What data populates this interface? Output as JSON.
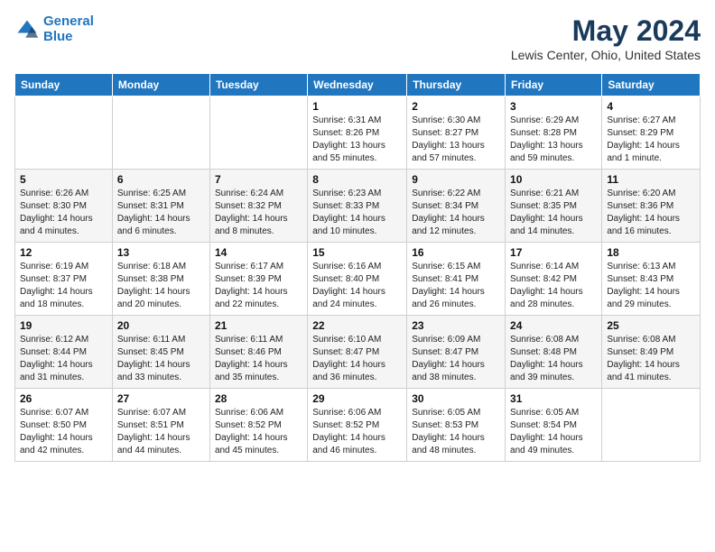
{
  "header": {
    "logo_line1": "General",
    "logo_line2": "Blue",
    "month_title": "May 2024",
    "location": "Lewis Center, Ohio, United States"
  },
  "days_of_week": [
    "Sunday",
    "Monday",
    "Tuesday",
    "Wednesday",
    "Thursday",
    "Friday",
    "Saturday"
  ],
  "weeks": [
    [
      {
        "day": "",
        "info": ""
      },
      {
        "day": "",
        "info": ""
      },
      {
        "day": "",
        "info": ""
      },
      {
        "day": "1",
        "info": "Sunrise: 6:31 AM\nSunset: 8:26 PM\nDaylight: 13 hours\nand 55 minutes."
      },
      {
        "day": "2",
        "info": "Sunrise: 6:30 AM\nSunset: 8:27 PM\nDaylight: 13 hours\nand 57 minutes."
      },
      {
        "day": "3",
        "info": "Sunrise: 6:29 AM\nSunset: 8:28 PM\nDaylight: 13 hours\nand 59 minutes."
      },
      {
        "day": "4",
        "info": "Sunrise: 6:27 AM\nSunset: 8:29 PM\nDaylight: 14 hours\nand 1 minute."
      }
    ],
    [
      {
        "day": "5",
        "info": "Sunrise: 6:26 AM\nSunset: 8:30 PM\nDaylight: 14 hours\nand 4 minutes."
      },
      {
        "day": "6",
        "info": "Sunrise: 6:25 AM\nSunset: 8:31 PM\nDaylight: 14 hours\nand 6 minutes."
      },
      {
        "day": "7",
        "info": "Sunrise: 6:24 AM\nSunset: 8:32 PM\nDaylight: 14 hours\nand 8 minutes."
      },
      {
        "day": "8",
        "info": "Sunrise: 6:23 AM\nSunset: 8:33 PM\nDaylight: 14 hours\nand 10 minutes."
      },
      {
        "day": "9",
        "info": "Sunrise: 6:22 AM\nSunset: 8:34 PM\nDaylight: 14 hours\nand 12 minutes."
      },
      {
        "day": "10",
        "info": "Sunrise: 6:21 AM\nSunset: 8:35 PM\nDaylight: 14 hours\nand 14 minutes."
      },
      {
        "day": "11",
        "info": "Sunrise: 6:20 AM\nSunset: 8:36 PM\nDaylight: 14 hours\nand 16 minutes."
      }
    ],
    [
      {
        "day": "12",
        "info": "Sunrise: 6:19 AM\nSunset: 8:37 PM\nDaylight: 14 hours\nand 18 minutes."
      },
      {
        "day": "13",
        "info": "Sunrise: 6:18 AM\nSunset: 8:38 PM\nDaylight: 14 hours\nand 20 minutes."
      },
      {
        "day": "14",
        "info": "Sunrise: 6:17 AM\nSunset: 8:39 PM\nDaylight: 14 hours\nand 22 minutes."
      },
      {
        "day": "15",
        "info": "Sunrise: 6:16 AM\nSunset: 8:40 PM\nDaylight: 14 hours\nand 24 minutes."
      },
      {
        "day": "16",
        "info": "Sunrise: 6:15 AM\nSunset: 8:41 PM\nDaylight: 14 hours\nand 26 minutes."
      },
      {
        "day": "17",
        "info": "Sunrise: 6:14 AM\nSunset: 8:42 PM\nDaylight: 14 hours\nand 28 minutes."
      },
      {
        "day": "18",
        "info": "Sunrise: 6:13 AM\nSunset: 8:43 PM\nDaylight: 14 hours\nand 29 minutes."
      }
    ],
    [
      {
        "day": "19",
        "info": "Sunrise: 6:12 AM\nSunset: 8:44 PM\nDaylight: 14 hours\nand 31 minutes."
      },
      {
        "day": "20",
        "info": "Sunrise: 6:11 AM\nSunset: 8:45 PM\nDaylight: 14 hours\nand 33 minutes."
      },
      {
        "day": "21",
        "info": "Sunrise: 6:11 AM\nSunset: 8:46 PM\nDaylight: 14 hours\nand 35 minutes."
      },
      {
        "day": "22",
        "info": "Sunrise: 6:10 AM\nSunset: 8:47 PM\nDaylight: 14 hours\nand 36 minutes."
      },
      {
        "day": "23",
        "info": "Sunrise: 6:09 AM\nSunset: 8:47 PM\nDaylight: 14 hours\nand 38 minutes."
      },
      {
        "day": "24",
        "info": "Sunrise: 6:08 AM\nSunset: 8:48 PM\nDaylight: 14 hours\nand 39 minutes."
      },
      {
        "day": "25",
        "info": "Sunrise: 6:08 AM\nSunset: 8:49 PM\nDaylight: 14 hours\nand 41 minutes."
      }
    ],
    [
      {
        "day": "26",
        "info": "Sunrise: 6:07 AM\nSunset: 8:50 PM\nDaylight: 14 hours\nand 42 minutes."
      },
      {
        "day": "27",
        "info": "Sunrise: 6:07 AM\nSunset: 8:51 PM\nDaylight: 14 hours\nand 44 minutes."
      },
      {
        "day": "28",
        "info": "Sunrise: 6:06 AM\nSunset: 8:52 PM\nDaylight: 14 hours\nand 45 minutes."
      },
      {
        "day": "29",
        "info": "Sunrise: 6:06 AM\nSunset: 8:52 PM\nDaylight: 14 hours\nand 46 minutes."
      },
      {
        "day": "30",
        "info": "Sunrise: 6:05 AM\nSunset: 8:53 PM\nDaylight: 14 hours\nand 48 minutes."
      },
      {
        "day": "31",
        "info": "Sunrise: 6:05 AM\nSunset: 8:54 PM\nDaylight: 14 hours\nand 49 minutes."
      },
      {
        "day": "",
        "info": ""
      }
    ]
  ]
}
